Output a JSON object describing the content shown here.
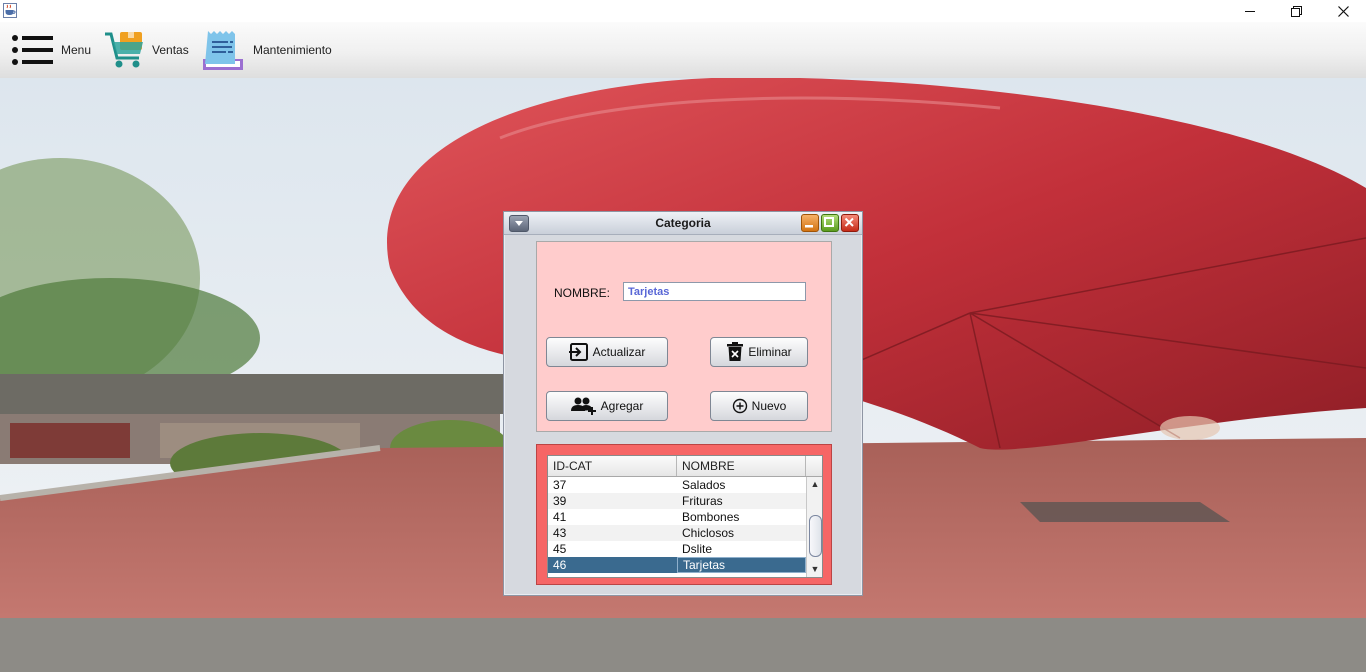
{
  "window": {
    "app_icon": "java-cup-icon",
    "controls": {
      "minimize": "minimize-icon",
      "maximize": "restore-icon",
      "close": "close-icon"
    }
  },
  "menubar": {
    "items": [
      {
        "label": "Menu",
        "icon": "hamburger-icon"
      },
      {
        "label": "Ventas",
        "icon": "shopping-cart-icon"
      },
      {
        "label": "Mantenimiento",
        "icon": "receipt-icon"
      }
    ]
  },
  "categoria_window": {
    "title": "Categoria",
    "form": {
      "nombre_label": "NOMBRE:",
      "nombre_value": "Tarjetas"
    },
    "buttons": {
      "actualizar": "Actualizar",
      "eliminar": "Eliminar",
      "agregar": "Agregar",
      "nuevo": "Nuevo"
    },
    "table": {
      "columns": [
        "ID-CAT",
        "NOMBRE"
      ],
      "rows": [
        {
          "id": "37",
          "nombre": "Salados"
        },
        {
          "id": "39",
          "nombre": "Frituras"
        },
        {
          "id": "41",
          "nombre": "Bombones"
        },
        {
          "id": "43",
          "nombre": "Chiclosos"
        },
        {
          "id": "45",
          "nombre": "Dslite"
        },
        {
          "id": "46",
          "nombre": "Tarjetas"
        }
      ],
      "selected_row": 5
    }
  },
  "colors": {
    "form_panel": "#ffcccc",
    "table_panel": "#f66666",
    "selected_row": "#3a6a8f",
    "input_text": "#5866d6"
  }
}
